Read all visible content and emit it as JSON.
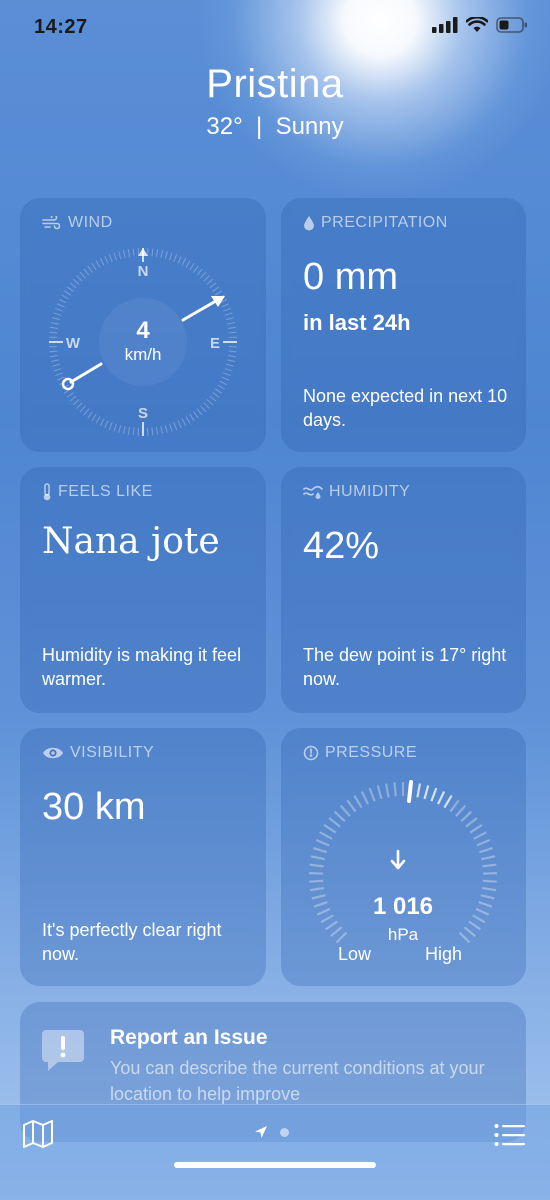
{
  "status_bar": {
    "time": "14:27"
  },
  "header": {
    "city": "Pristina",
    "conditions": "32°  |  Sunny"
  },
  "wind": {
    "title": "WIND",
    "speed": "4",
    "unit": "km/h",
    "directions": {
      "n": "N",
      "e": "E",
      "s": "S",
      "w": "W"
    }
  },
  "precipitation": {
    "title": "PRECIPITATION",
    "amount": "0 mm",
    "period": "in last 24h",
    "description": "None expected in next 10 days."
  },
  "feels_like": {
    "title": "FEELS LIKE",
    "value": "Nana jote",
    "description": "Humidity is making it feel warmer."
  },
  "humidity": {
    "title": "HUMIDITY",
    "value": "42%",
    "description": "The dew point is 17° right now."
  },
  "visibility": {
    "title": "VISIBILITY",
    "value": "30 km",
    "description": "It's perfectly clear right now."
  },
  "pressure": {
    "title": "PRESSURE",
    "value": "1 016",
    "unit": "hPa",
    "low_label": "Low",
    "high_label": "High"
  },
  "report": {
    "title": "Report an Issue",
    "description": "You can describe the current conditions at your location to help improve"
  },
  "tab_bar": {
    "page_count": 2,
    "active_page": 1
  },
  "colors": {
    "sky": "#4f86d2",
    "card": "#3a70c0"
  },
  "icons": {
    "wind": "wind-icon",
    "precipitation": "raindrop-icon",
    "feels_like": "thermometer-icon",
    "humidity": "humidity-icon",
    "visibility": "eye-icon",
    "pressure": "gauge-icon",
    "map": "map-icon",
    "location": "location-arrow-icon",
    "list": "list-icon",
    "report": "exclamation-bubble-icon"
  }
}
